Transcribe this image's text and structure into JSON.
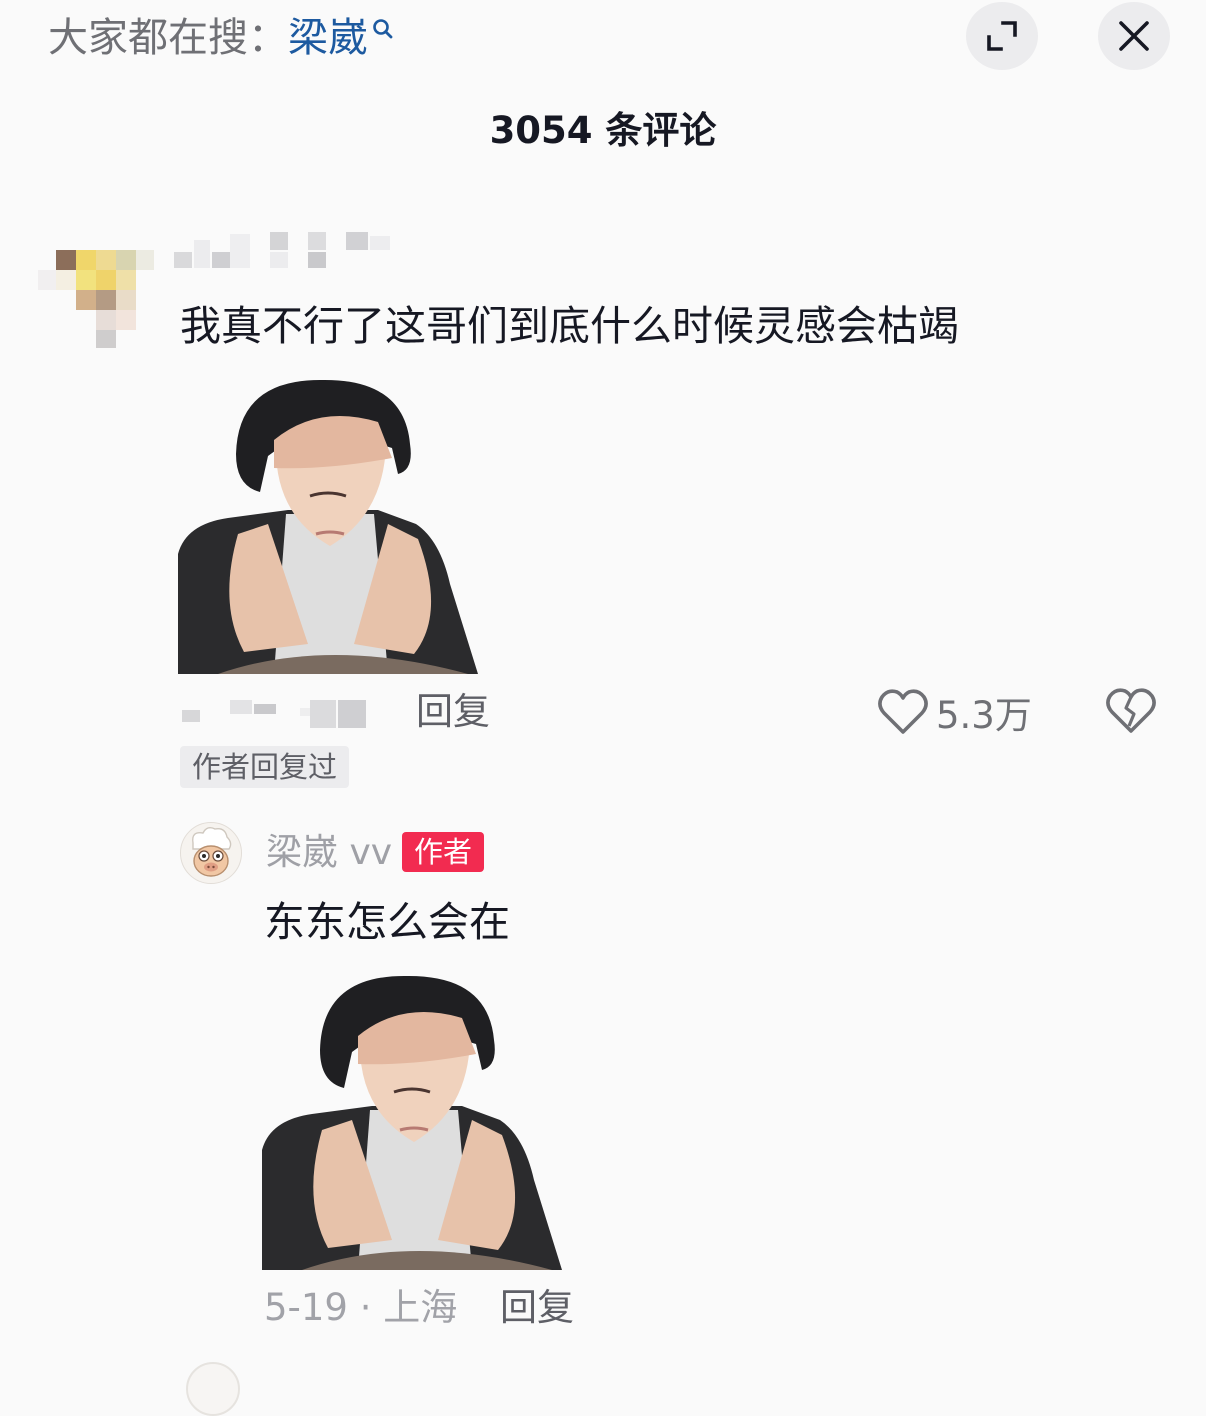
{
  "header": {
    "hot_search_prefix": "大家都在搜：",
    "hot_search_term": "梁崴",
    "expand_icon": "expand-icon",
    "close_icon": "close-icon"
  },
  "comments_header": {
    "count_text": "3054 条评论"
  },
  "comment": {
    "username": "",
    "text": "我真不行了这哥们到底什么时候灵感会枯竭",
    "sticker": "sticker-image",
    "meta": "",
    "reply_label": "回复",
    "like_count": "5.3万",
    "author_replied_tag": "作者回复过",
    "reply": {
      "author_name": "梁崴 vv",
      "author_badge": "作者",
      "text": "东东怎么会在",
      "sticker": "sticker-image",
      "meta": "5-19 · 上海",
      "reply_label": "回复"
    }
  },
  "colors": {
    "background": "#fafafa",
    "hot_term": "#1d5aa0",
    "author_badge": "#f22b50",
    "primary_text": "#161823",
    "secondary_text": "#6f7075"
  }
}
